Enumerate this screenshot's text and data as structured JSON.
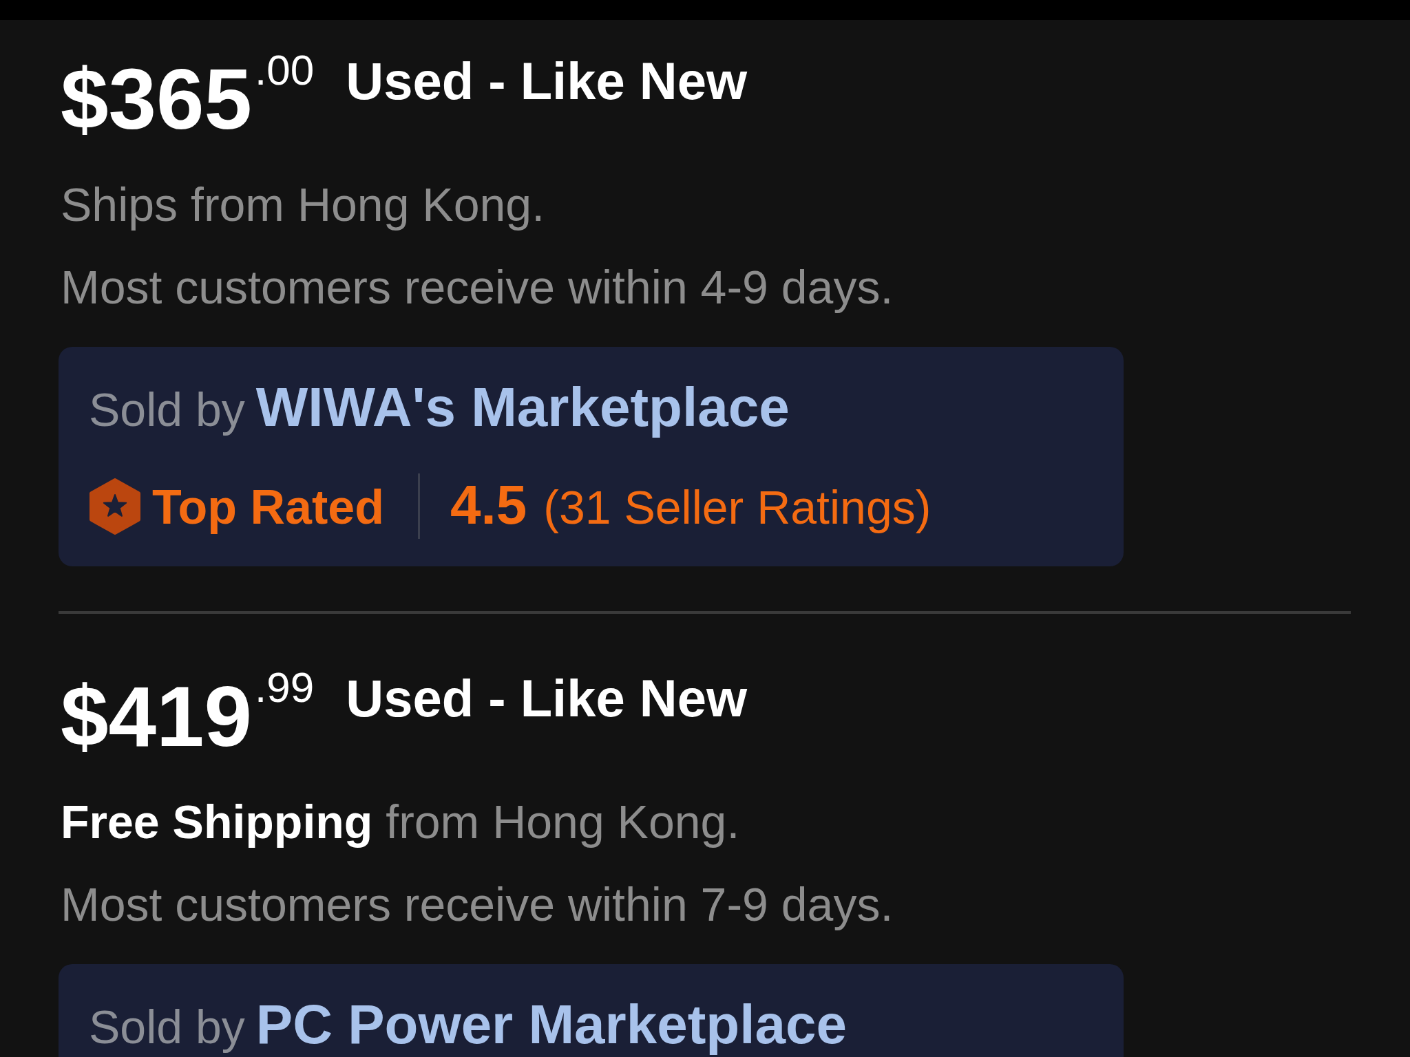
{
  "listings": [
    {
      "price": "$365",
      "cents": ".00",
      "condition": "Used - Like New",
      "shipping": "Ships from Hong Kong.",
      "delivery": "Most customers receive within 4-9 days.",
      "seller": {
        "label": "Sold by",
        "name": "WIWA's Marketplace",
        "badge": "Top Rated",
        "rating": "4.5",
        "rating_count": "(31 Seller Ratings)"
      }
    },
    {
      "price": "$419",
      "cents": ".99",
      "condition": "Used - Like New",
      "shipping": "**Free Shipping** from Hong Kong.",
      "delivery": "Most customers receive within 7-9 days.",
      "seller": {
        "label": "Sold by",
        "name": "PC Power Marketplace"
      }
    }
  ]
}
